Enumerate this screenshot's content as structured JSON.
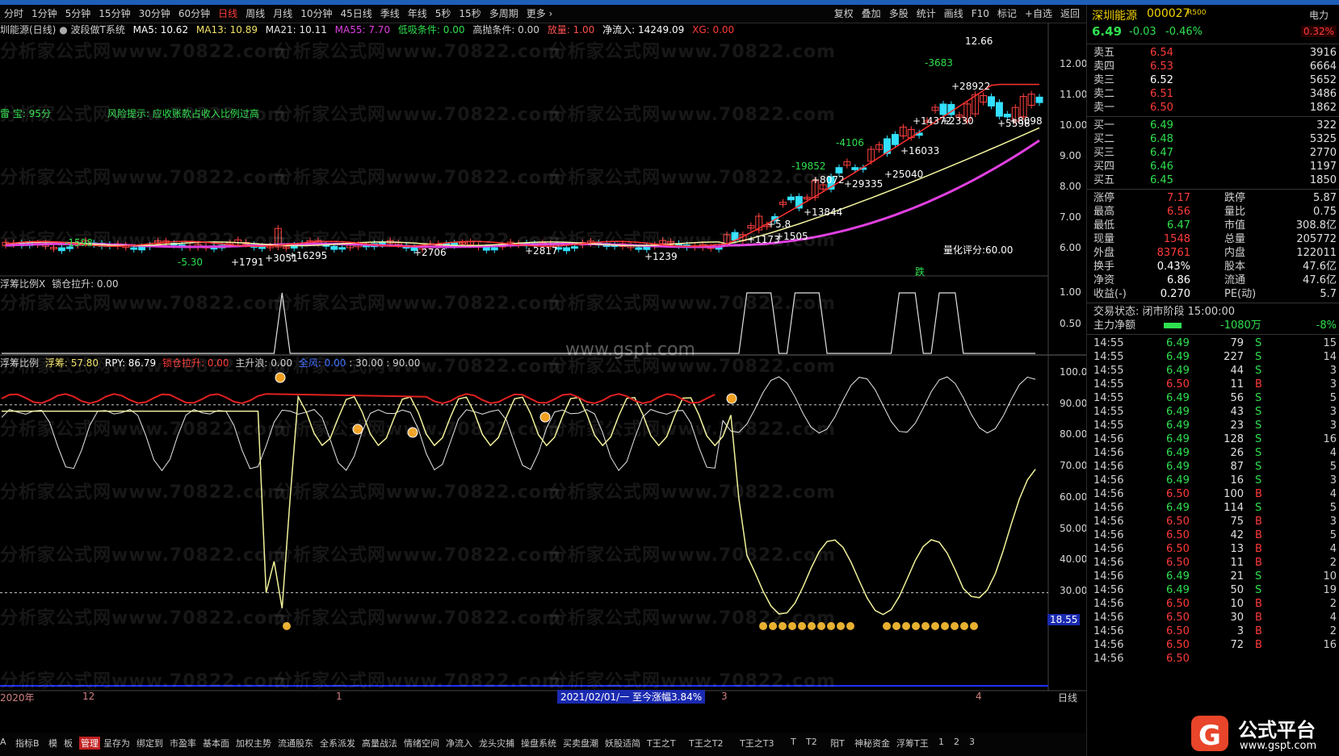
{
  "menu": {
    "periods": [
      "分时",
      "1分钟",
      "5分钟",
      "15分钟",
      "30分钟",
      "60分钟",
      "日线",
      "周线",
      "月线",
      "10分钟",
      "45日线",
      "季线",
      "年线",
      "5秒",
      "15秒",
      "多周期",
      "更多 ›"
    ],
    "active": "日线",
    "right": [
      "复权",
      "叠加",
      "多股",
      "统计",
      "画线",
      "F10",
      "标记",
      "+自选",
      "返回"
    ]
  },
  "infobar": {
    "title": "圳能源(日线)",
    "system": "波段做T系统",
    "ma5": "MA5: 10.62",
    "ma13": "MA13: 10.89",
    "ma21": "MA21: 10.11",
    "ma55": "MA55: 7.70",
    "low_cond": "低吸条件: 0.00",
    "high_cond": "高抛条件: 0.00",
    "volume": "放量: 1.00",
    "netflow": "净流入: 14249.09",
    "xg": "XG: 0.00"
  },
  "leftnotes": {
    "score": "雷 宝:   95分",
    "risk": "风险提示:   应收账款占收入比例过高",
    "quant": "量化评分:60.00",
    "die": "跌"
  },
  "sub1": {
    "label": "浮筹比例X",
    "lock": "锁仓拉升: 0.00"
  },
  "sub2": {
    "label": "浮筹比例",
    "fuchou": "浮筹: 57.80",
    "rpy": "RPY: 86.79",
    "lock": "锁仓拉升: 0.00",
    "rise": "主升浪: 0.00",
    "full": "全风: 0.00",
    "levels": ": 30.00 : 90.00"
  },
  "axis_main": [
    "12.00",
    "11.00",
    "10.00",
    "9.00",
    "8.00",
    "7.00",
    "6.00"
  ],
  "axis_sub1": [
    "1.00",
    "0.50"
  ],
  "axis_sub2": [
    "100.0",
    "90.00",
    "80.00",
    "70.00",
    "60.00",
    "50.00",
    "40.00",
    "30.00"
  ],
  "current_marker": "18.55",
  "high_label": "12.66",
  "watermark": "分析家公式网www.70822.com",
  "center_wm": "www.gspt.com",
  "candle_labels": [
    "+3051",
    "+1791",
    "-5.30",
    "+2706",
    "+2817",
    "+1239",
    "+1173",
    "+13844",
    "+8072",
    "+29335",
    "+25040",
    "+16033",
    "+14372",
    "+2330",
    "+28922",
    "+5598",
    "+8098",
    "-3683",
    "-4106",
    "-19852",
    "-1598",
    "+16295",
    "+1505",
    "+5.8"
  ],
  "timeline": {
    "y2020": "2020年",
    "m12": "12",
    "m1": "1",
    "date": "2021/02/01/一  至今涨幅3.84%",
    "m3": "3",
    "m4": "4",
    "period": "日线"
  },
  "bottom_tabs": [
    "A",
    "指标B",
    "模",
    "板",
    "管理",
    "呈存为",
    "绑定到",
    "市盈率",
    "基本面",
    "加权主势",
    "流通股东",
    "全系派发",
    "高量战法",
    "情绪空间",
    "净流入",
    "龙头灾捕",
    "操盘系统",
    "买卖盘潮",
    "妖股适简",
    "T王之T",
    "T王之T2",
    "T王之T3",
    "T",
    "T2",
    "阳T",
    "神秘资金",
    "浮筹T王",
    "1",
    "2",
    "3"
  ],
  "stock": {
    "name": "深圳能源",
    "code": "000027",
    "tag": "R500",
    "sector": "电力",
    "price": "6.49",
    "change": "-0.03",
    "pct": "-0.46%",
    "pct2": "0.32%"
  },
  "asks": [
    {
      "l": "卖五",
      "p": "6.54",
      "v": "3916"
    },
    {
      "l": "卖四",
      "p": "6.53",
      "v": "6664"
    },
    {
      "l": "卖三",
      "p": "6.52",
      "v": "5652"
    },
    {
      "l": "卖二",
      "p": "6.51",
      "v": "3486"
    },
    {
      "l": "卖一",
      "p": "6.50",
      "v": "1862"
    }
  ],
  "bids": [
    {
      "l": "买一",
      "p": "6.49",
      "v": "322"
    },
    {
      "l": "买二",
      "p": "6.48",
      "v": "5325"
    },
    {
      "l": "买三",
      "p": "6.47",
      "v": "2770"
    },
    {
      "l": "买四",
      "p": "6.46",
      "v": "1197"
    },
    {
      "l": "买五",
      "p": "6.45",
      "v": "1850"
    }
  ],
  "stats": [
    {
      "a": "涨停",
      "av": "7.17",
      "b": "跌停",
      "bv": "5.87"
    },
    {
      "a": "最高",
      "av": "6.56",
      "b": "量比",
      "bv": "0.75"
    },
    {
      "a": "最低",
      "av": "6.47",
      "b": "市值",
      "bv": "308.8亿"
    },
    {
      "a": "现量",
      "av": "1548",
      "b": "总量",
      "bv": "205772"
    },
    {
      "a": "外盘",
      "av": "83761",
      "b": "内盘",
      "bv": "122011"
    },
    {
      "a": "换手",
      "av": "0.43%",
      "b": "股本",
      "bv": "47.6亿"
    },
    {
      "a": "净资",
      "av": "6.86",
      "b": "流通",
      "bv": "47.6亿"
    },
    {
      "a": "收益(-)",
      "av": "0.270",
      "b": "PE(动)",
      "bv": "5.7"
    }
  ],
  "trade_state": "交易状态: 闭市阶段 15:00:00",
  "main_net": {
    "label": "主力净额",
    "value": "-1080万",
    "pct": "-8%"
  },
  "ticks": [
    [
      "14:55",
      "6.49",
      "79",
      "S",
      "15"
    ],
    [
      "14:55",
      "6.49",
      "227",
      "S",
      "14"
    ],
    [
      "14:55",
      "6.49",
      "44",
      "S",
      "3"
    ],
    [
      "14:55",
      "6.50",
      "11",
      "B",
      "3"
    ],
    [
      "14:55",
      "6.49",
      "56",
      "S",
      "5"
    ],
    [
      "14:55",
      "6.49",
      "43",
      "S",
      "3"
    ],
    [
      "14:55",
      "6.49",
      "23",
      "S",
      "3"
    ],
    [
      "14:56",
      "6.49",
      "128",
      "S",
      "16"
    ],
    [
      "14:56",
      "6.49",
      "26",
      "S",
      "4"
    ],
    [
      "14:56",
      "6.49",
      "87",
      "S",
      "5"
    ],
    [
      "14:56",
      "6.49",
      "16",
      "S",
      "3"
    ],
    [
      "14:56",
      "6.50",
      "100",
      "B",
      "4"
    ],
    [
      "14:56",
      "6.49",
      "114",
      "S",
      "5"
    ],
    [
      "14:56",
      "6.50",
      "75",
      "B",
      "3"
    ],
    [
      "14:56",
      "6.50",
      "42",
      "B",
      "5"
    ],
    [
      "14:56",
      "6.50",
      "13",
      "B",
      "4"
    ],
    [
      "14:56",
      "6.50",
      "11",
      "B",
      "2"
    ],
    [
      "14:56",
      "6.49",
      "21",
      "S",
      "10"
    ],
    [
      "14:56",
      "6.49",
      "50",
      "S",
      "19"
    ],
    [
      "14:56",
      "6.50",
      "10",
      "B",
      "2"
    ],
    [
      "14:56",
      "6.50",
      "30",
      "B",
      "4"
    ],
    [
      "14:56",
      "6.50",
      "3",
      "B",
      "2"
    ],
    [
      "14:56",
      "6.50",
      "72",
      "B",
      "16"
    ],
    [
      "14:56",
      "6.50",
      "",
      "",
      ""
    ]
  ],
  "logo": {
    "text": "公式平台",
    "url": "www.gspt.com"
  }
}
